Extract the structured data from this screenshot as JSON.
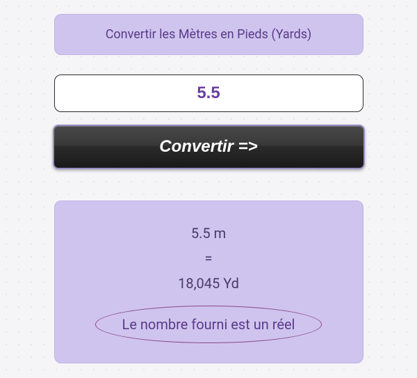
{
  "header": {
    "title": "Convertir les Mètres en Pieds (Yards)"
  },
  "input": {
    "value": "5.5"
  },
  "button": {
    "label": "Convertir =>"
  },
  "result": {
    "source": "5.5 m",
    "equals": "=",
    "target": "18,045 Yd",
    "note": "Le nombre fourni est un réel"
  }
}
